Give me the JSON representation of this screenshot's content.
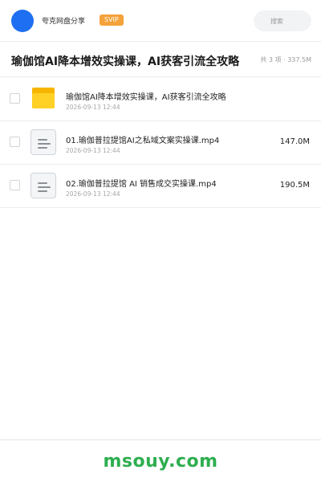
{
  "header": {
    "app_name": "夸克网盘分享",
    "badge": "SVIP",
    "search_placeholder": "搜索",
    "accent_color": "#1e6ff1",
    "badge_color": "#f4a23a"
  },
  "share": {
    "title": "瑜伽馆AI降本增效实操课，AI获客引流全攻略",
    "summary": "共 3 项 · 337.5M"
  },
  "files": [
    {
      "type": "folder",
      "icon": "folder-icon",
      "name": "瑜伽馆AI降本增效实操课，AI获客引流全攻略",
      "date": "2026-09-13 12:44",
      "size": ""
    },
    {
      "type": "file",
      "icon": "document-icon",
      "name": "01.瑜伽普拉提馆AI之私域文案实操课.mp4",
      "date": "2026-09-13 12:44",
      "size": "147.0M"
    },
    {
      "type": "file",
      "icon": "document-icon",
      "name": "02.瑜伽普拉提馆 AI 销售成交实操课.mp4",
      "date": "2026-09-13 12:44",
      "size": "190.5M"
    }
  ],
  "footer": {
    "watermark": "msouy.com",
    "watermark_color": "#2eae4f"
  }
}
